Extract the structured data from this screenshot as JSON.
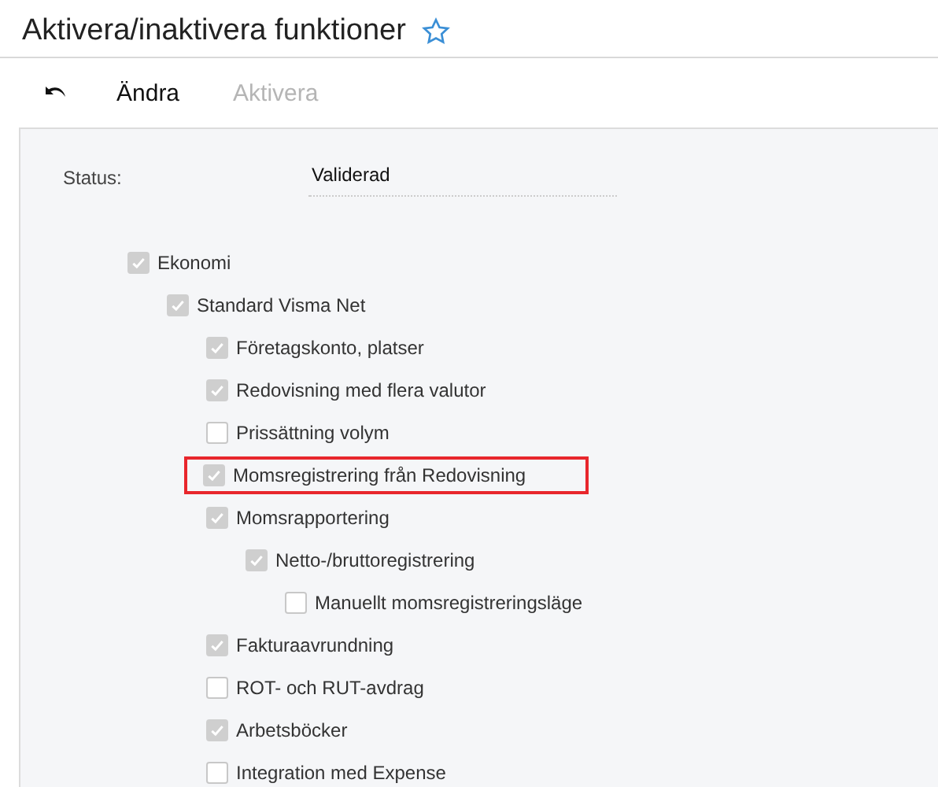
{
  "page": {
    "title": "Aktivera/inaktivera funktioner",
    "favorite": false
  },
  "toolbar": [
    {
      "kind": "undo",
      "disabled": false
    },
    {
      "kind": "text",
      "label": "Ändra",
      "disabled": false
    },
    {
      "kind": "text",
      "label": "Aktivera",
      "disabled": true
    }
  ],
  "status": {
    "label": "Status:",
    "value": "Validerad"
  },
  "features": [
    {
      "label": "Ekonomi",
      "checked": true,
      "highlighted": false,
      "children": [
        {
          "label": "Standard Visma Net",
          "checked": true,
          "highlighted": false,
          "children": [
            {
              "label": "Företagskonto, platser",
              "checked": true,
              "highlighted": false
            },
            {
              "label": "Redovisning med flera valutor",
              "checked": true,
              "highlighted": false
            },
            {
              "label": "Prissättning volym",
              "checked": false,
              "highlighted": false
            },
            {
              "label": "Momsregistrering från Redovisning",
              "checked": true,
              "highlighted": true
            },
            {
              "label": "Momsrapportering",
              "checked": true,
              "highlighted": false,
              "children": [
                {
                  "label": "Netto-/bruttoregistrering",
                  "checked": true,
                  "highlighted": false,
                  "children": [
                    {
                      "label": "Manuellt momsregistreringsläge",
                      "checked": false,
                      "highlighted": false
                    }
                  ]
                }
              ]
            },
            {
              "label": "Fakturaavrundning",
              "checked": true,
              "highlighted": false
            },
            {
              "label": "ROT- och RUT-avdrag",
              "checked": false,
              "highlighted": false
            },
            {
              "label": "Arbetsböcker",
              "checked": true,
              "highlighted": false
            },
            {
              "label": "Integration med Expense",
              "checked": false,
              "highlighted": false
            }
          ]
        }
      ]
    }
  ]
}
